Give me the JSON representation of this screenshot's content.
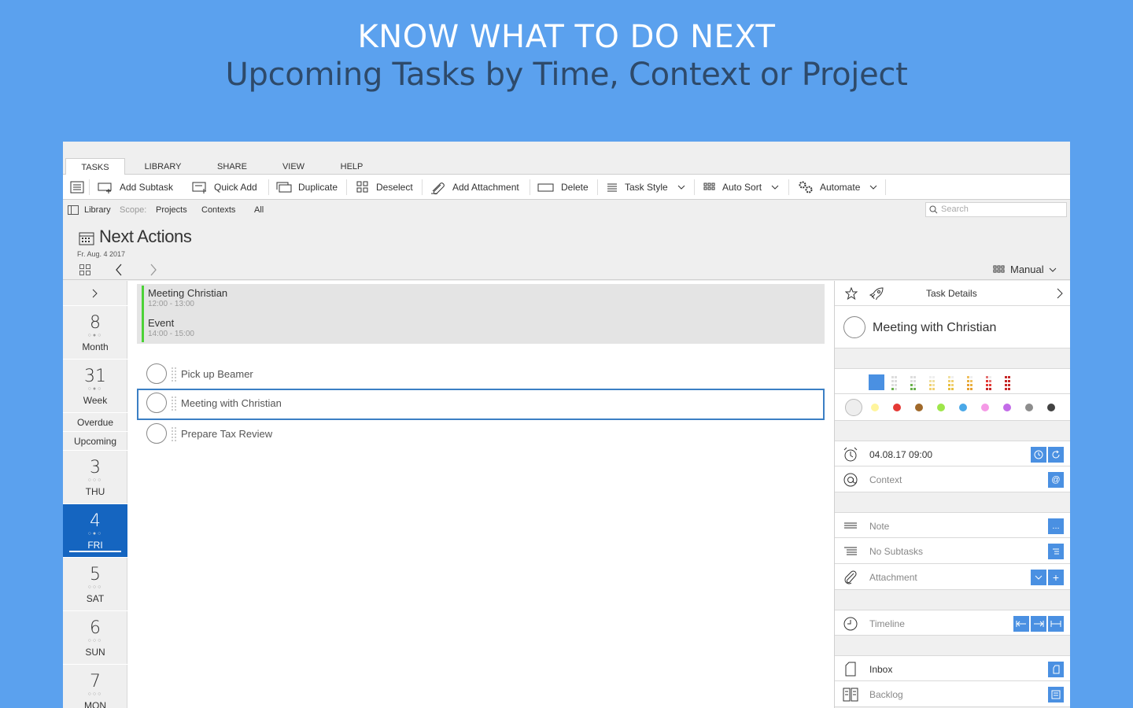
{
  "hero": {
    "headline": "KNOW WHAT TO DO NEXT",
    "subline": "Upcoming Tasks by Time, Context or Project"
  },
  "tabs": [
    {
      "label": "TASKS",
      "active": true
    },
    {
      "label": "LIBRARY",
      "active": false
    },
    {
      "label": "SHARE",
      "active": false
    },
    {
      "label": "VIEW",
      "active": false
    },
    {
      "label": "HELP",
      "active": false
    }
  ],
  "toolbar": {
    "add_subtask": "Add Subtask",
    "quick_add": "Quick Add",
    "duplicate": "Duplicate",
    "deselect": "Deselect",
    "add_attachment": "Add Attachment",
    "delete": "Delete",
    "task_style": "Task Style",
    "auto_sort": "Auto Sort",
    "automate": "Automate"
  },
  "scope": {
    "library": "Library",
    "scope_label": "Scope:",
    "projects": "Projects",
    "contexts": "Contexts",
    "all": "All",
    "search_placeholder": "Search"
  },
  "page": {
    "title": "Next Actions",
    "date": "Fr. Aug. 4 2017",
    "sort_mode": "Manual"
  },
  "strip": {
    "month": {
      "num": "8",
      "label": "Month"
    },
    "week": {
      "num": "31",
      "label": "Week"
    },
    "overdue": "Overdue",
    "upcoming": "Upcoming",
    "days": [
      {
        "num": "3",
        "label": "THU",
        "selected": false
      },
      {
        "num": "4",
        "label": "FRI",
        "selected": true
      },
      {
        "num": "5",
        "label": "SAT",
        "selected": false
      },
      {
        "num": "6",
        "label": "SUN",
        "selected": false
      },
      {
        "num": "7",
        "label": "MON",
        "selected": false
      }
    ]
  },
  "events": [
    {
      "title": "Meeting Christian",
      "time": "12:00 - 13:00"
    },
    {
      "title": "Event",
      "time": "14:00 - 15:00"
    }
  ],
  "tasks": [
    {
      "title": "Pick up Beamer",
      "selected": false
    },
    {
      "title": "Meeting with Christian",
      "selected": true
    },
    {
      "title": "Prepare Tax Review",
      "selected": false
    }
  ],
  "details": {
    "header": "Task Details",
    "task_title": "Meeting with Christian",
    "due": "04.08.17 09:00",
    "context": "Context",
    "note": "Note",
    "subtasks": "No Subtasks",
    "attachment": "Attachment",
    "timeline": "Timeline",
    "inbox": "Inbox",
    "backlog": "Backlog",
    "note_button": "...",
    "attach_add": "+",
    "context_button": "@"
  },
  "colors": {
    "accent": "#4a90e2",
    "selected_day": "#1565c0",
    "background": "#5ba1ee",
    "event_bar": "#4cd137",
    "label_colors": [
      "#eeeeee",
      "#fff59d",
      "#e53935",
      "#a0692a",
      "#9ee64a",
      "#4aa8e8",
      "#f59ae6",
      "#c36be8",
      "#8d8d8d",
      "#424242"
    ]
  }
}
